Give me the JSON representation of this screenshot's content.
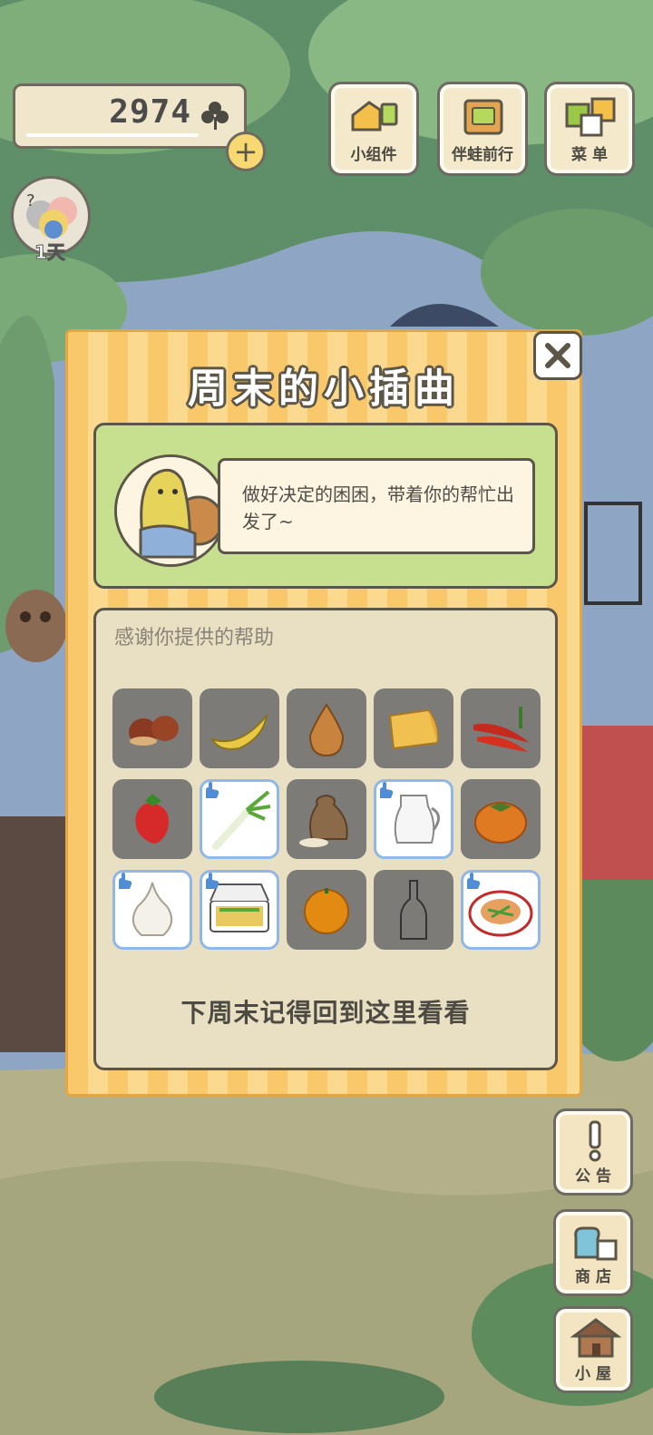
{
  "hud": {
    "clover_count": "2974",
    "add_symbol": "+",
    "days_label": "1天"
  },
  "top_buttons": [
    {
      "label": "小组件",
      "icon": "widget-icon"
    },
    {
      "label": "伴蛙前行",
      "icon": "travel-journal-icon"
    },
    {
      "label": "菜 单",
      "icon": "menu-icon"
    }
  ],
  "side_buttons": [
    {
      "label": "公 告",
      "icon": "notice-icon"
    },
    {
      "label": "商 店",
      "icon": "shop-bag-icon"
    },
    {
      "label": "小 屋",
      "icon": "house-icon"
    }
  ],
  "dialog": {
    "title": "周末的小插曲",
    "message": "做好决定的困困，带着你的帮忙出发了~",
    "thanks_title": "感谢你提供的帮助",
    "footer": "下周末记得回到这里看看"
  },
  "items": [
    {
      "name": "chestnut-icon",
      "given": false
    },
    {
      "name": "banana-icon",
      "given": false
    },
    {
      "name": "onion-icon",
      "given": false
    },
    {
      "name": "cheese-icon",
      "given": false
    },
    {
      "name": "chili-pepper-icon",
      "given": false
    },
    {
      "name": "strawberry-icon",
      "given": false
    },
    {
      "name": "green-onion-icon",
      "given": true
    },
    {
      "name": "rice-sack-icon",
      "given": false
    },
    {
      "name": "milk-jug-icon",
      "given": true
    },
    {
      "name": "persimmon-icon",
      "given": false
    },
    {
      "name": "garlic-icon",
      "given": true
    },
    {
      "name": "bento-box-icon",
      "given": true
    },
    {
      "name": "orange-icon",
      "given": false
    },
    {
      "name": "glass-bottle-icon",
      "given": false
    },
    {
      "name": "pasta-plate-icon",
      "given": true
    }
  ],
  "colors": {
    "dialog_stripe_a": "#f8c86a",
    "dialog_stripe_b": "#fbd98e",
    "message_panel": "#c7e08f",
    "given_border": "#8fb8e8",
    "empty_cell": "#7d7b78"
  }
}
